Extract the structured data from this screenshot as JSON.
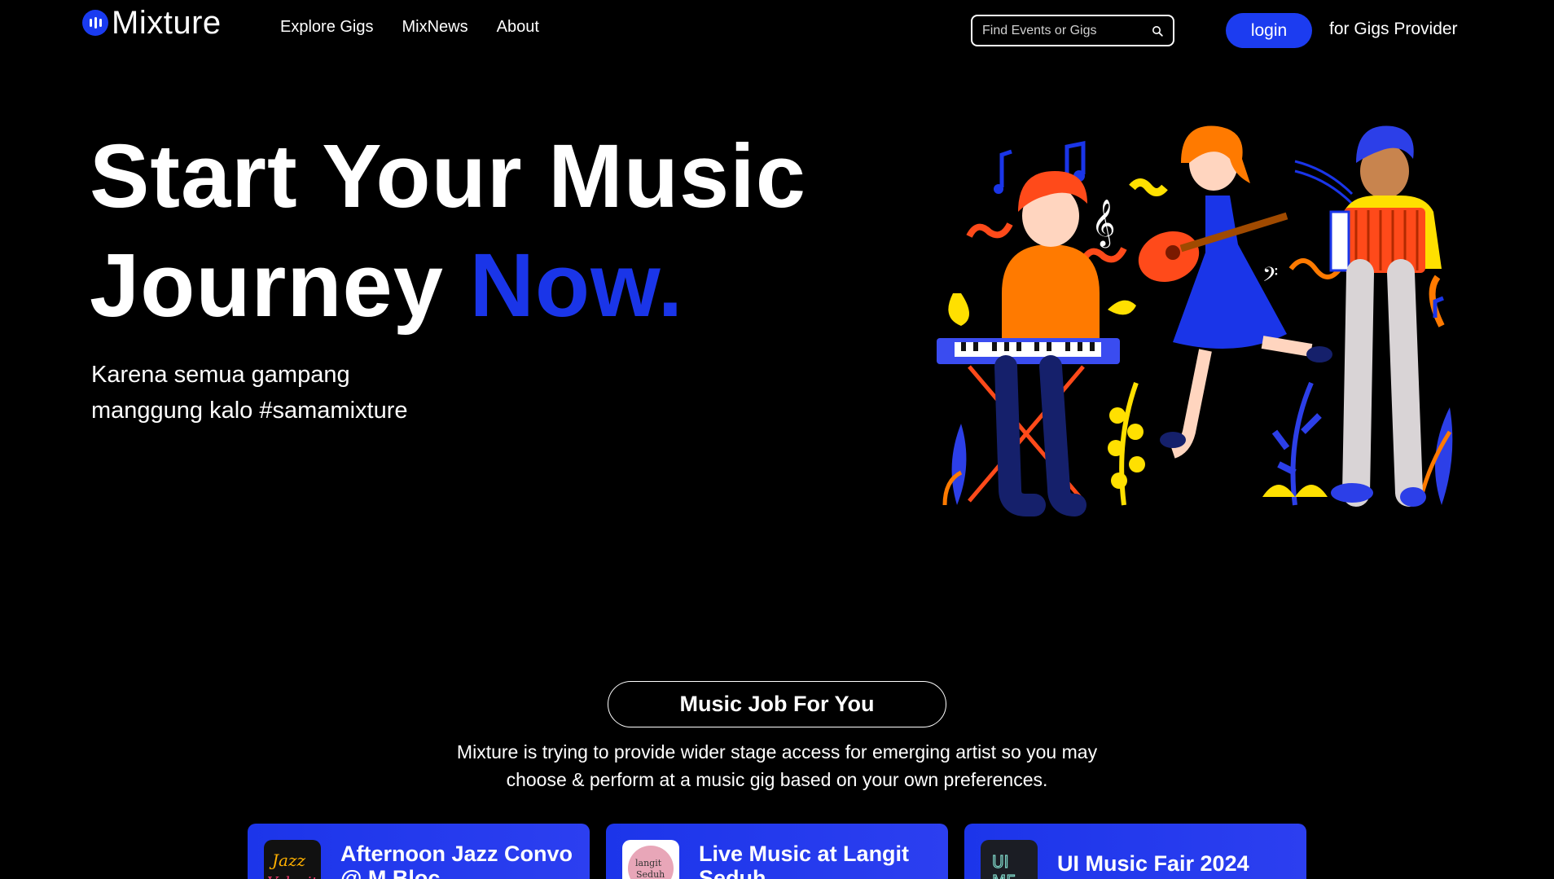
{
  "brand": {
    "name": "Mixture",
    "accent": "#1a35e8"
  },
  "nav": {
    "links": [
      "Explore Gigs",
      "MixNews",
      "About"
    ],
    "search_placeholder": "Find Events or Gigs",
    "login_label": "login",
    "provider_label": "for Gigs Provider"
  },
  "hero": {
    "title_line1": "Start Your Music",
    "title_line2_prefix": "Journey ",
    "title_line2_accent": "Now.",
    "subtitle_line1": "Karena semua gampang",
    "subtitle_line2": "manggung kalo #samamixture"
  },
  "section": {
    "pill": "Music Job For You",
    "description_line1": "Mixture is trying to provide wider stage access for emerging artist so you may",
    "description_line2": "choose & perform at a music gig based on your own preferences."
  },
  "cards": [
    {
      "title": "Afternoon Jazz Convo @ M Bloc",
      "thumb": "Jazz Velocity",
      "thumb_icon": "jazz-logo-icon"
    },
    {
      "title": "Live Music at Langit Seduh",
      "thumb": "langit Seduh",
      "thumb_icon": "langit-seduh-logo-icon"
    },
    {
      "title": "UI Music Fair 2024",
      "thumb": "UI MF",
      "thumb_icon": "ui-music-fair-logo-icon"
    }
  ]
}
